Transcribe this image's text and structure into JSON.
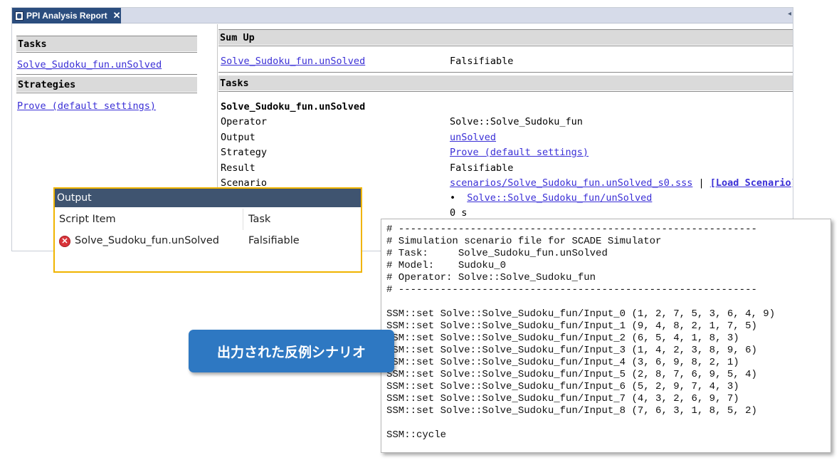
{
  "window": {
    "tab_title": "PPI Analysis Report",
    "tab_close": "✕",
    "tab_chevron": "◂"
  },
  "left": {
    "tasks_header": "Tasks",
    "task_link": "Solve_Sudoku_fun.unSolved",
    "strategies_header": "Strategies",
    "strategy_link": "Prove (default settings)"
  },
  "sumup": {
    "header": "Sum Up",
    "task_link": "Solve_Sudoku_fun.unSolved",
    "result": "Falsifiable"
  },
  "tasks": {
    "header": "Tasks",
    "task_title": "Solve_Sudoku_fun.unSolved",
    "rows": [
      {
        "label": "Operator",
        "value": "Solve::Solve_Sudoku_fun"
      },
      {
        "label": "Output",
        "value": "unSolved"
      },
      {
        "label": "Strategy",
        "value": "Prove (default settings)"
      },
      {
        "label": "Result",
        "value": "Falsifiable"
      },
      {
        "label": "Scenario",
        "value": "scenarios/Solve_Sudoku_fun.unSolved_s0.sss"
      }
    ],
    "scenario_separator": "|",
    "load_scenario": "[Load Scenario]",
    "bullet": "•",
    "bullet_link": "Solve::Solve_Sudoku_fun/unSolved",
    "time": "0 s"
  },
  "output": {
    "title": "Output",
    "col_script_item": "Script Item",
    "col_task": "Task",
    "error_icon": "✕",
    "row_item": "Solve_Sudoku_fun.unSolved",
    "row_task": "Falsifiable"
  },
  "scenario_file": {
    "lines": [
      "# ------------------------------------------------------------",
      "# Simulation scenario file for SCADE Simulator",
      "# Task:     Solve_Sudoku_fun.unSolved",
      "# Model:    Sudoku_0",
      "# Operator: Solve::Solve_Sudoku_fun",
      "# ------------------------------------------------------------",
      "",
      "SSM::set Solve::Solve_Sudoku_fun/Input_0 (1, 2, 7, 5, 3, 6, 4, 9)",
      "SSM::set Solve::Solve_Sudoku_fun/Input_1 (9, 4, 8, 2, 1, 7, 5)",
      "SSM::set Solve::Solve_Sudoku_fun/Input_2 (6, 5, 4, 1, 8, 3)",
      "SSM::set Solve::Solve_Sudoku_fun/Input_3 (1, 4, 2, 3, 8, 9, 6)",
      "SSM::set Solve::Solve_Sudoku_fun/Input_4 (3, 6, 9, 8, 2, 1)",
      "SSM::set Solve::Solve_Sudoku_fun/Input_5 (2, 8, 7, 6, 9, 5, 4)",
      "SSM::set Solve::Solve_Sudoku_fun/Input_6 (5, 2, 9, 7, 4, 3)",
      "SSM::set Solve::Solve_Sudoku_fun/Input_7 (4, 3, 2, 6, 9, 7)",
      "SSM::set Solve::Solve_Sudoku_fun/Input_8 (7, 6, 3, 1, 8, 5, 2)",
      "",
      "SSM::cycle"
    ]
  },
  "callout": {
    "text": "出力された反例シナリオ"
  }
}
